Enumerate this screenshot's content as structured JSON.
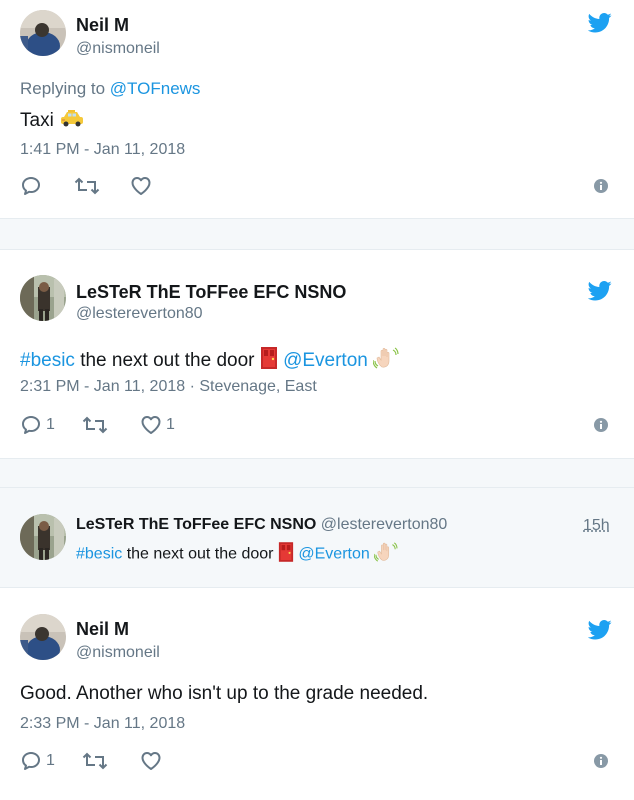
{
  "tweets": [
    {
      "name": "Neil M",
      "handle": "@nismoneil",
      "replying_prefix": "Replying to",
      "replying_handle": "@TOFnews",
      "text": "Taxi",
      "emoji": "taxi",
      "timestamp": "1:41 PM - Jan 11, 2018"
    },
    {
      "name": "LeSTeR ThE ToFFee EFC NSNO",
      "handle": "@lestereverton80",
      "hashtag": "#besic",
      "text": " the next out the door ",
      "mention": "@Everton",
      "timestamp": "2:31 PM - Jan 11, 2018",
      "location": " · Stevenage, East",
      "reply_count": "1",
      "like_count": "1"
    },
    {
      "name": "Neil M",
      "handle": "@nismoneil",
      "text": "Good. Another who isn't up to the grade needed.",
      "timestamp": "2:33 PM - Jan 11, 2018",
      "reply_count": "1"
    }
  ],
  "quoted": {
    "name": "LeSTeR ThE ToFFee EFC NSNO",
    "handle": "@lestereverton80",
    "time": "15h",
    "hashtag": "#besic",
    "text": " the next out the door ",
    "mention": "@Everton"
  },
  "colors": {
    "accent": "#1da1f2",
    "link": "#1b95e0",
    "muted": "#657786"
  }
}
